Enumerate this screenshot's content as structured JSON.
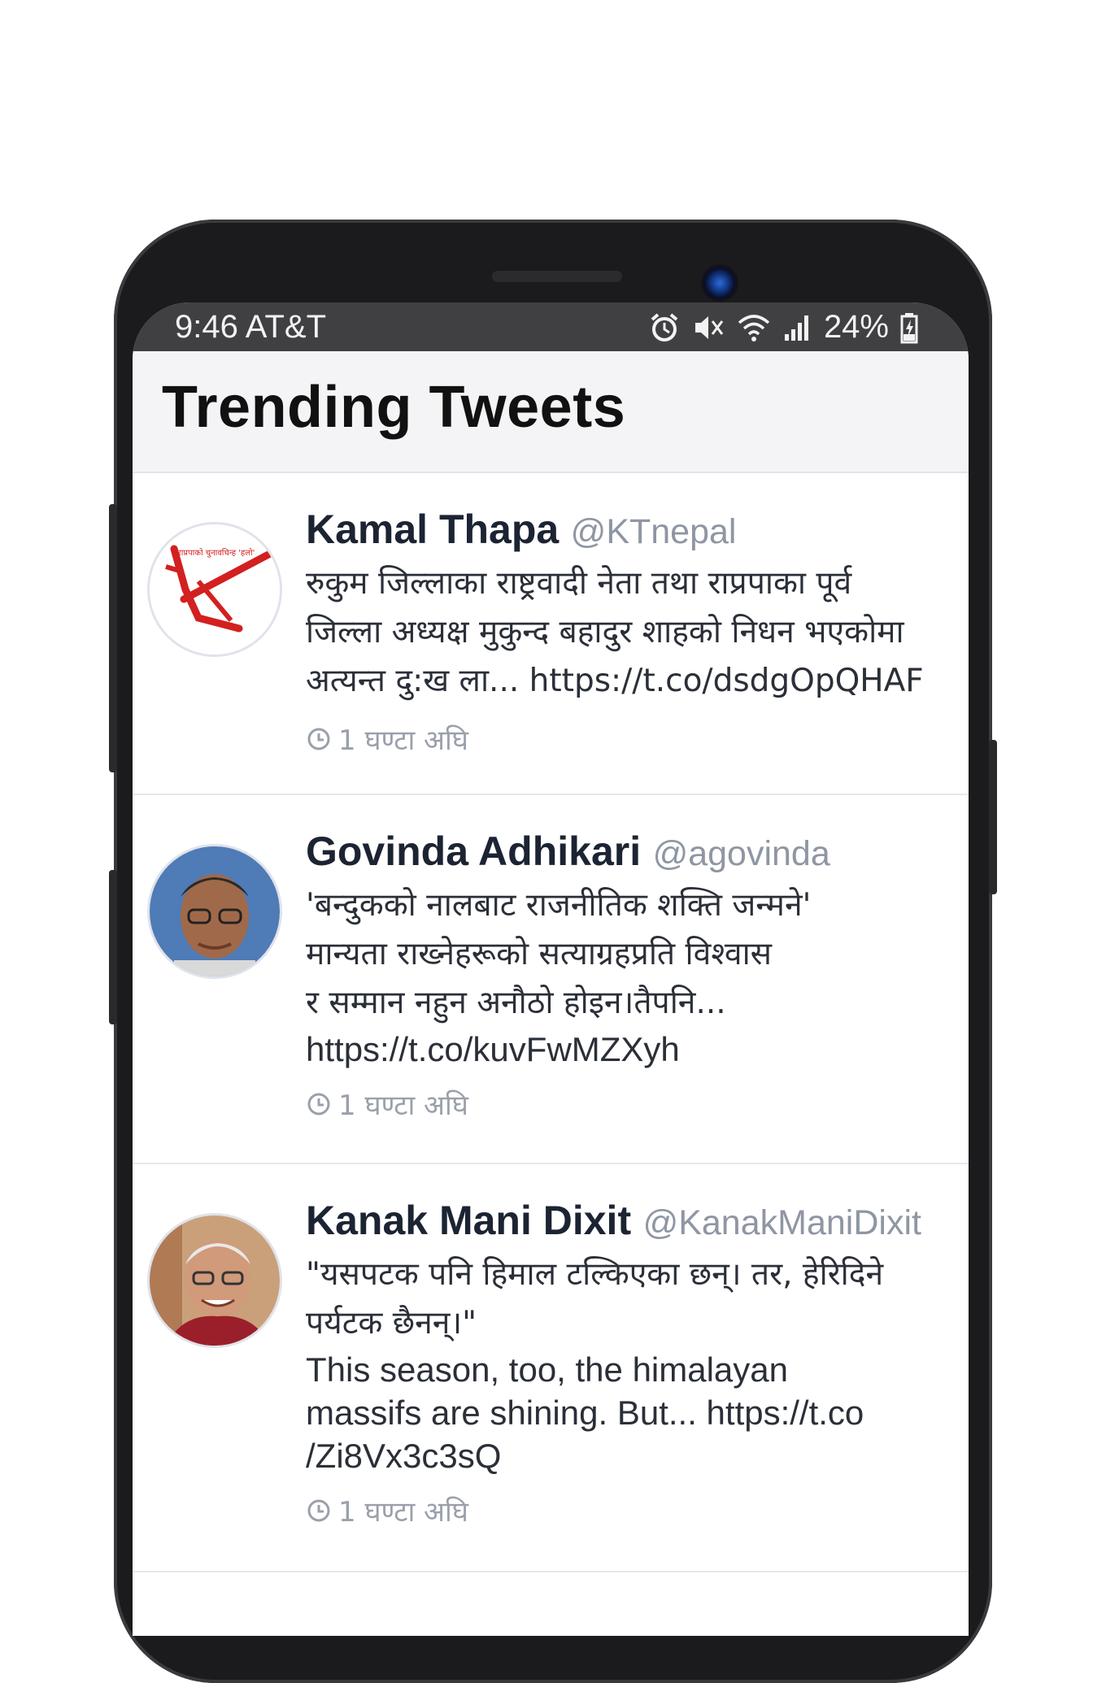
{
  "status_bar": {
    "time_carrier": "9:46 AT&T",
    "battery": "24%",
    "icons": [
      "alarm-icon",
      "mute-icon",
      "wifi-icon",
      "signal-icon",
      "battery-charging-icon"
    ]
  },
  "header": {
    "title": "Trending Tweets"
  },
  "tweets": [
    {
      "name": "Kamal Thapa",
      "handle": "@KTnepal",
      "avatar": "rpp-logo-avatar",
      "text": "रुकुम जिल्लाका राष्ट्रवादी नेता तथा राप्रपाका पूर्व\nजिल्ला अध्यक्ष मुकुन्द बहादुर शाहको निधन भएकोमा\nअत्यन्त दु:ख ला... https://t.co/dsdgOpQHAF",
      "time": "1 घण्टा अघि",
      "logo_text": "राप्रपाको चुनावचिन्ह 'हलो'"
    },
    {
      "name": "Govinda Adhikari",
      "handle": "@agovinda",
      "avatar": "user-photo-avatar",
      "text": "'बन्दुकको नालबाट राजनीतिक शक्ति जन्मने'\nमान्यता राख्नेहरूको सत्याग्रहप्रति विश्वास\nर सम्मान नहुन अनौठो होइन।तैपनि...",
      "text_en": "https://t.co/kuvFwMZXyh",
      "time": "1 घण्टा अघि"
    },
    {
      "name": "Kanak Mani Dixit",
      "handle": "@KanakManiDixit",
      "avatar": "user-photo-avatar",
      "text": "\"यसपटक पनि हिमाल टल्किएका छन्। तर, हेरिदिने\nपर्यटक छैनन्।\"",
      "text_en": "This season, too, the himalayan\nmassifs are shining. But... https://t.co\n/Zi8Vx3c3sQ",
      "time": "1 घण्टा अघि"
    }
  ]
}
